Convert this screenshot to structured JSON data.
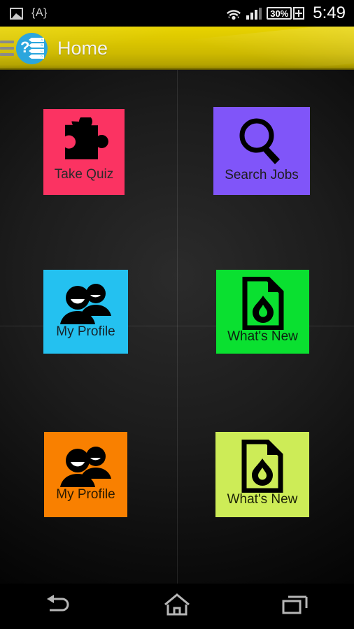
{
  "statusbar": {
    "left_icons": [
      {
        "name": "photo-icon",
        "glyph": "image"
      },
      {
        "name": "keyboard-indicator",
        "text": "{A}"
      }
    ],
    "right_icons": [
      {
        "name": "wifi-icon"
      },
      {
        "name": "cellular-signal-icon"
      }
    ],
    "battery_percent": "30%",
    "battery_charging": true,
    "time": "5:49"
  },
  "actionbar": {
    "menu_icon": "hamburger-menu-icon",
    "app_logo": "quiz-app-logo-icon",
    "logo_question_mark": "?",
    "logo_options": [
      "A",
      "B",
      "C",
      "D"
    ],
    "title": "Home",
    "background_color": "#d8c400"
  },
  "grid": {
    "tiles": [
      {
        "id": "take-quiz",
        "label": "Take Quiz",
        "icon": "puzzle-piece-icon",
        "color": "#fb3362",
        "text_color": "#2a2a2a"
      },
      {
        "id": "search-jobs",
        "label": "Search Jobs",
        "icon": "magnifying-glass-icon",
        "color": "#8055f9",
        "text_color": "#1d1d1d"
      },
      {
        "id": "my-profile-1",
        "label": "My Profile",
        "icon": "people-group-icon",
        "color": "#24c1f0",
        "text_color": "#17232b"
      },
      {
        "id": "whats-new-1",
        "label": "What's New",
        "icon": "document-flame-icon",
        "color": "#0ae030",
        "text_color": "#0d2010"
      },
      {
        "id": "my-profile-2",
        "label": "My Profile",
        "icon": "people-group-icon",
        "color": "#f98000",
        "text_color": "#2b1a00"
      },
      {
        "id": "whats-new-2",
        "label": "What's New",
        "icon": "document-flame-icon",
        "color": "#cdec57",
        "text_color": "#1c2207"
      }
    ]
  },
  "navbar": {
    "buttons": [
      {
        "name": "back-button",
        "icon": "back-arrow-icon"
      },
      {
        "name": "home-button",
        "icon": "home-icon"
      },
      {
        "name": "recents-button",
        "icon": "recent-apps-icon"
      }
    ]
  }
}
